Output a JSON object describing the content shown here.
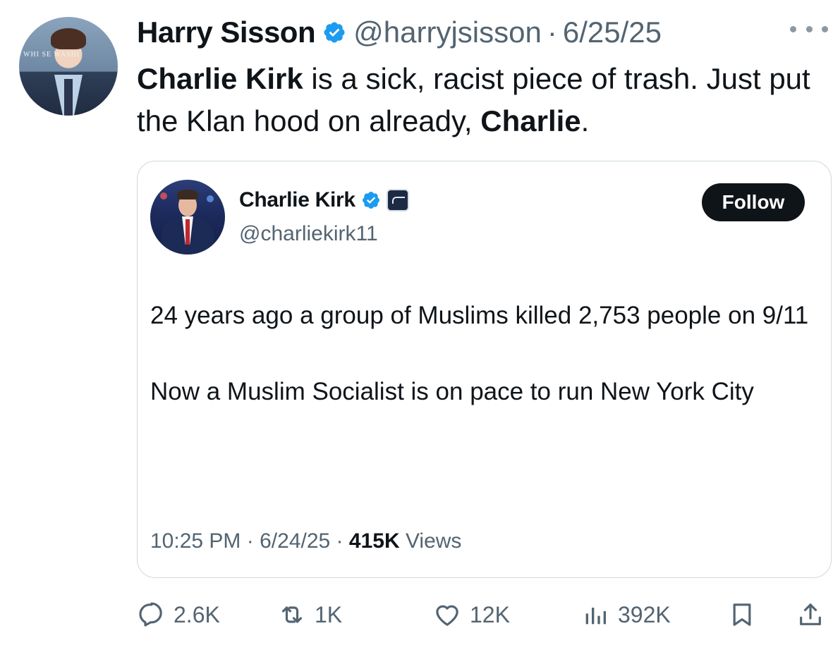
{
  "tweet": {
    "author": {
      "name": "Harry Sisson",
      "handle": "@harryjsisson",
      "date": "6/25/25",
      "avatar_icon": "profile-photo",
      "avatar_backdrop_text": "WHI  SE  WASHI"
    },
    "separator": "·",
    "text": {
      "part1_bold": "Charlie Kirk",
      "part2": " is a sick, racist piece of trash. Just put the Klan hood on already, ",
      "part3_bold": "Charlie",
      "part4": "."
    },
    "stats": {
      "replies": "2.6K",
      "reposts": "1K",
      "likes": "12K",
      "views": "392K"
    }
  },
  "quoted_tweet": {
    "author": {
      "name": "Charlie Kirk",
      "handle": "@charliekirk11",
      "avatar_icon": "profile-photo"
    },
    "follow_label": "Follow",
    "paragraphs": [
      "24 years ago a group of Muslims killed 2,753 people on 9/11",
      "Now a Muslim Socialist is on pace to run New York City"
    ],
    "meta": {
      "time": "10:25 PM",
      "date": "6/24/25",
      "views_count": "415K",
      "views_label": "Views"
    }
  },
  "colors": {
    "text": "#0f1419",
    "secondary": "#536471",
    "verified_blue": "#1d9bf0",
    "border": "#cfd9de",
    "follow_bg": "#0f1419"
  },
  "icons": [
    "verified-badge-icon",
    "more-icon",
    "reply-icon",
    "repost-icon",
    "like-icon",
    "views-icon",
    "bookmark-icon",
    "share-icon",
    "org-affiliation-icon"
  ]
}
